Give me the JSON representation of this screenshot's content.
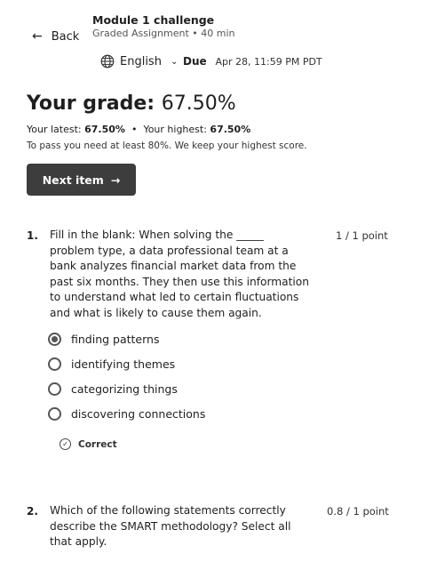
{
  "header": {
    "back_label": "Back",
    "module_title": "Module 1 challenge",
    "module_subtitle": "Graded Assignment • 40 min",
    "language": "English",
    "due_label": "Due",
    "due_date": "Apr 28, 11:59 PM PDT"
  },
  "grade": {
    "label": "Your grade:",
    "value": "67.50%",
    "latest_label": "Your latest:",
    "latest_value": "67.50%",
    "separator": "•",
    "highest_label": "Your highest:",
    "highest_value": "67.50%",
    "pass_note": "To pass you need at least 80%. We keep your highest score."
  },
  "next_button": {
    "label": "Next item",
    "icon": "arrow-right-icon"
  },
  "questions": [
    {
      "number": "1.",
      "lines": [
        "Fill in the blank: When solving the _____",
        "problem type, a data professional team at a",
        "bank analyzes financial market data from the",
        "past six months. They then use this information",
        "to understand what led to certain fluctuations",
        "and what is likely to cause them again."
      ],
      "points": "1 / 1 point",
      "options": [
        {
          "label": "finding patterns",
          "selected": true
        },
        {
          "label": "identifying themes",
          "selected": false
        },
        {
          "label": "categorizing things",
          "selected": false
        },
        {
          "label": "discovering connections",
          "selected": false
        }
      ],
      "result": "Correct"
    },
    {
      "number": "2.",
      "lines": [
        "Which of the following statements correctly",
        "describe the SMART methodology? Select all",
        "that apply."
      ],
      "points": "0.8 / 1 point"
    }
  ]
}
